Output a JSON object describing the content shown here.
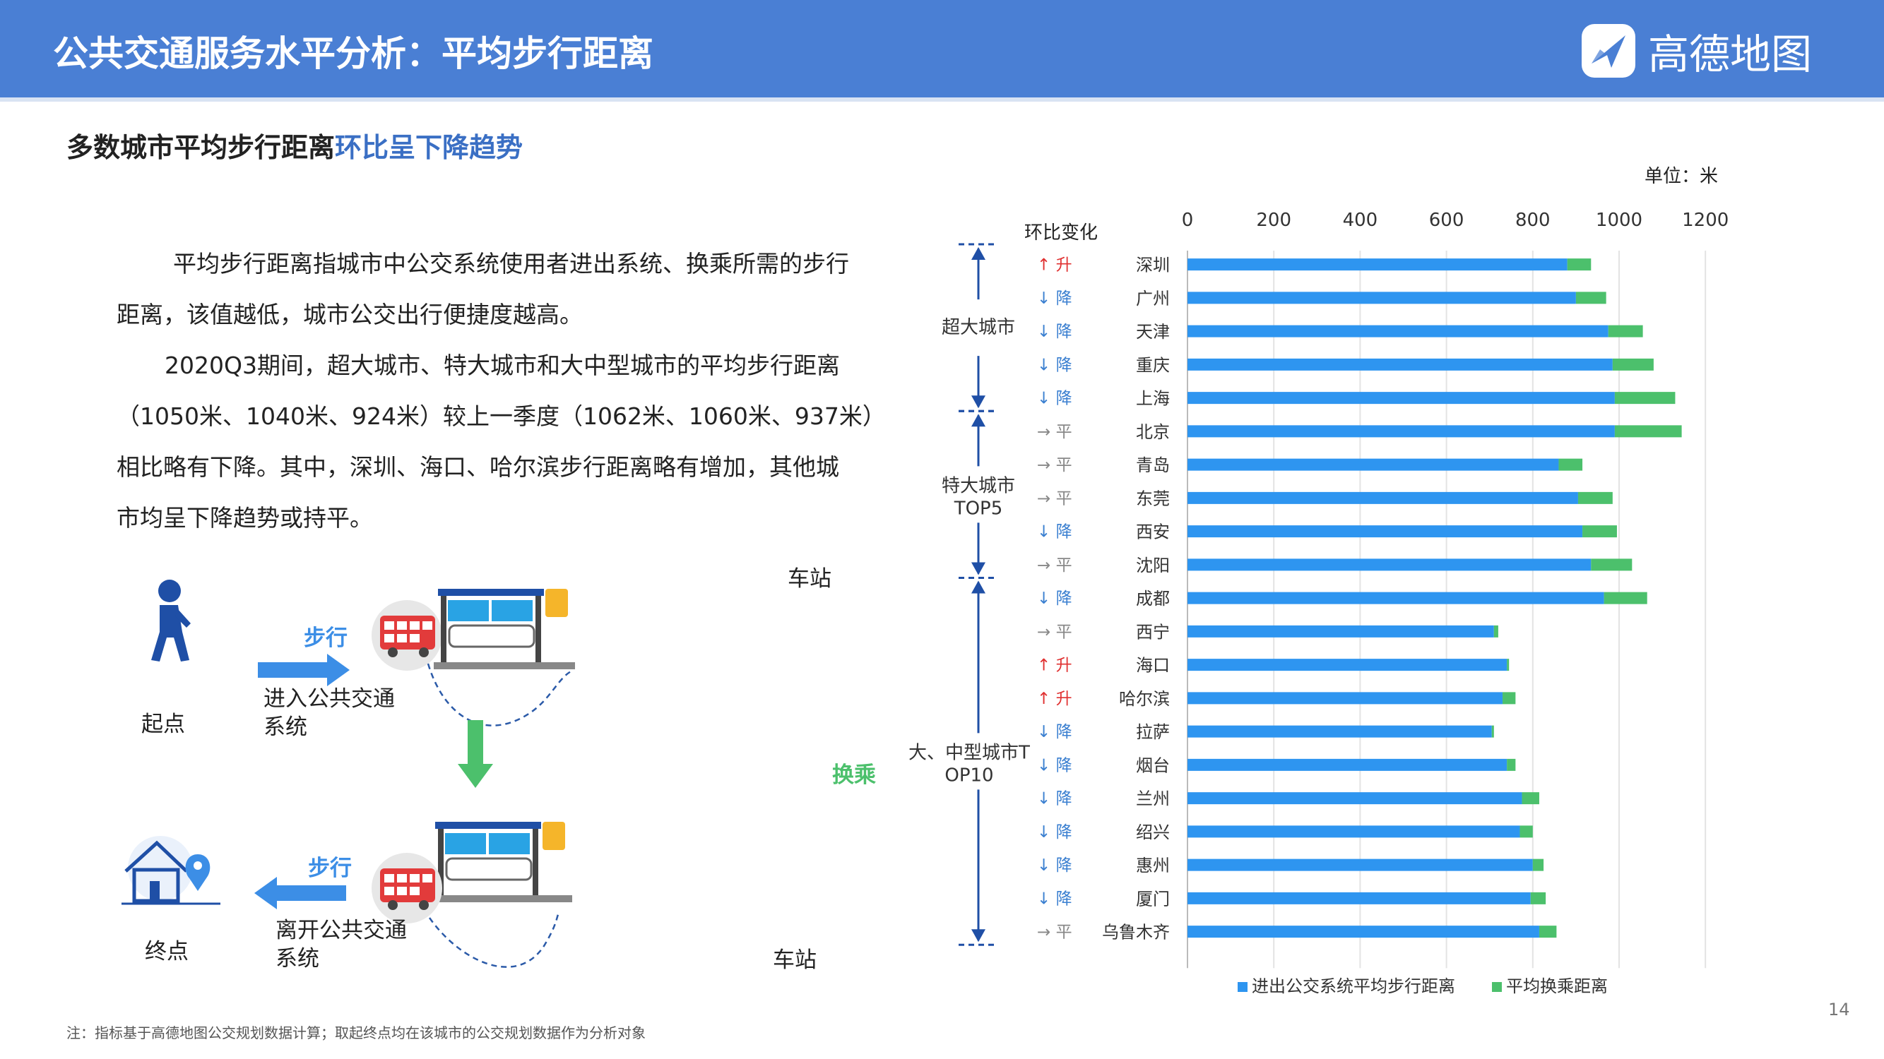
{
  "header": {
    "title": "公共交通服务水平分析：平均步行距离",
    "brand": "高德地图",
    "brand_color": "#4a7fd4"
  },
  "subtitle": {
    "prefix": "多数城市平均步行距离",
    "highlight": "环比呈下降趋势"
  },
  "body": {
    "lines": [
      "平均步行距离指城市中公交系统使用者进出系统、换乘所需的步行",
      "距离，该值越低，城市公交出行便捷度越高。",
      "2020Q3期间，超大城市、特大城市和大中型城市的平均步行距离",
      "（1050米、1040米、924米）较上一季度（1062米、1060米、937米）",
      "相比略有下降。其中，深圳、海口、哈尔滨步行距离略有增加，其他城",
      "市均呈下降趋势或持平。"
    ]
  },
  "diagram": {
    "start_label": "起点",
    "end_label": "终点",
    "walk_label_top": "步行",
    "walk_label_bottom": "步行",
    "enter_label": "进入公共交通系统",
    "leave_label": "离开公共交通系统",
    "station_label_top": "车站",
    "station_label_bottom": "车站",
    "transfer_label": "换乘",
    "icons": [
      "walking-person-icon",
      "bus-icon",
      "bus-stop-icon",
      "home-location-icon",
      "arrow-right-icon",
      "arrow-left-icon",
      "arrow-down-icon"
    ]
  },
  "footnote": "注：指标基于高德地图公交规划数据计算；取起终点均在该城市的公交规划数据作为分析对象",
  "page_number": "14",
  "chart_data": {
    "type": "bar",
    "stacked": true,
    "orientation": "horizontal",
    "unit_label": "单位：米",
    "change_header": "环比变化",
    "categories": [
      "深圳",
      "广州",
      "天津",
      "重庆",
      "上海",
      "北京",
      "青岛",
      "东莞",
      "西安",
      "沈阳",
      "成都",
      "西宁",
      "海口",
      "哈尔滨",
      "拉萨",
      "烟台",
      "兰州",
      "绍兴",
      "惠州",
      "厦门",
      "乌鲁木齐"
    ],
    "changes": [
      "↑ 升",
      "↓ 降",
      "↓ 降",
      "↓ 降",
      "↓ 降",
      "→ 平",
      "→ 平",
      "→ 平",
      "↓ 降",
      "→ 平",
      "↓ 降",
      "→ 平",
      "↑ 升",
      "↑ 升",
      "↓ 降",
      "↓ 降",
      "↓ 降",
      "↓ 降",
      "↓ 降",
      "↓ 降",
      "→ 平"
    ],
    "change_colors": {
      "↑ 升": "#e03030",
      "↓ 降": "#3a7fd0",
      "→ 平": "#888888"
    },
    "groups": [
      {
        "label": "超大城市",
        "start": 0,
        "end": 5
      },
      {
        "label": "特大城市TOP5",
        "start": 5,
        "end": 10
      },
      {
        "label": "大、中型城市TOP10",
        "start": 10,
        "end": 21
      }
    ],
    "series": [
      {
        "name": "进出公交系统平均步行距离",
        "color": "#2e95f0",
        "values": [
          880,
          900,
          975,
          985,
          990,
          990,
          860,
          905,
          915,
          935,
          965,
          710,
          740,
          730,
          705,
          740,
          775,
          770,
          800,
          795,
          815
        ]
      },
      {
        "name": "平均换乘距离",
        "color": "#4cc06c",
        "values": [
          55,
          70,
          80,
          95,
          140,
          155,
          55,
          80,
          80,
          95,
          100,
          10,
          5,
          30,
          5,
          20,
          40,
          30,
          25,
          35,
          40
        ]
      }
    ],
    "xlim": [
      0,
      1200
    ],
    "xticks": [
      0,
      200,
      400,
      600,
      800,
      1000,
      1200
    ],
    "grid": true,
    "legend_position": "bottom"
  }
}
